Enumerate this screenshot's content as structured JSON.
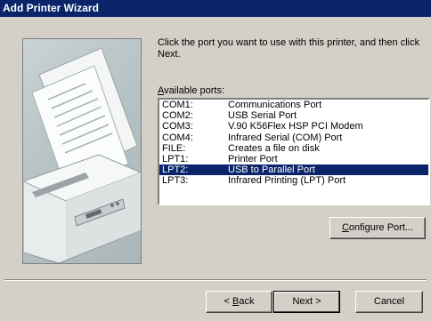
{
  "window": {
    "title": "Add Printer Wizard"
  },
  "instructions": "Click the port you want to use with this printer, and then click Next.",
  "ports_label": {
    "accel": "A",
    "rest": "vailable ports:"
  },
  "ports": [
    {
      "port": "COM1:",
      "description": "Communications Port"
    },
    {
      "port": "COM2:",
      "description": "USB Serial Port"
    },
    {
      "port": "COM3:",
      "description": "V.90 K56Flex HSP PCI Modem"
    },
    {
      "port": "COM4:",
      "description": "Infrared Serial (COM) Port"
    },
    {
      "port": "FILE:",
      "description": "Creates a file on disk"
    },
    {
      "port": "LPT1:",
      "description": "Printer Port"
    },
    {
      "port": "LPT2:",
      "description": "USB to Parallel Port"
    },
    {
      "port": "LPT3:",
      "description": "Infrared Printing (LPT) Port"
    }
  ],
  "selected_port_index": 6,
  "buttons": {
    "configure": {
      "accel": "C",
      "rest": "onfigure Port..."
    },
    "back": {
      "prefix": "< ",
      "accel": "B",
      "rest": "ack"
    },
    "next": "Next >",
    "cancel": "Cancel"
  },
  "colors": {
    "selection": "#0a246a",
    "face": "#d4d0c8",
    "title_bar": "#0a246a"
  },
  "icons": [
    "printer-illustration"
  ]
}
